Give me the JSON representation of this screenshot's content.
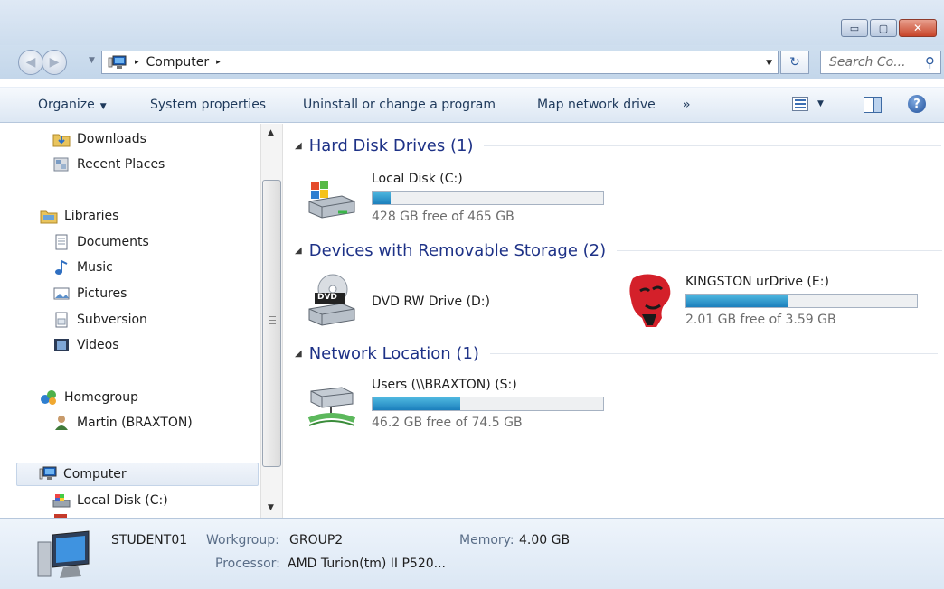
{
  "window": {
    "minimize_glyph": "▭",
    "maximize_glyph": "▢",
    "close_glyph": "✕"
  },
  "address": {
    "crumbs": [
      "Computer"
    ],
    "separator": "▸",
    "search_placeholder": "Search Co...",
    "refresh_glyph": "↻"
  },
  "commands": {
    "organize": "Organize",
    "system_properties": "System properties",
    "uninstall": "Uninstall or change a program",
    "map_drive": "Map network drive",
    "more": "»"
  },
  "nav": {
    "items": [
      {
        "label": "Downloads",
        "icon": "downloads-folder-icon"
      },
      {
        "label": "Recent Places",
        "icon": "recent-places-icon"
      },
      {
        "label": "Libraries",
        "icon": "libraries-icon"
      },
      {
        "label": "Documents",
        "icon": "documents-icon"
      },
      {
        "label": "Music",
        "icon": "music-icon"
      },
      {
        "label": "Pictures",
        "icon": "pictures-icon"
      },
      {
        "label": "Subversion",
        "icon": "subversion-icon"
      },
      {
        "label": "Videos",
        "icon": "videos-icon"
      },
      {
        "label": "Homegroup",
        "icon": "homegroup-icon"
      },
      {
        "label": "Martin (BRAXTON)",
        "icon": "user-icon"
      },
      {
        "label": "Computer",
        "icon": "computer-icon"
      },
      {
        "label": "Local Disk (C:)",
        "icon": "local-disk-icon"
      }
    ]
  },
  "groups": {
    "hdd": {
      "title": "Hard Disk Drives (1)"
    },
    "removable": {
      "title": "Devices with Removable Storage (2)"
    },
    "network": {
      "title": "Network Location (1)"
    }
  },
  "drives": {
    "c": {
      "name": "Local Disk (C:)",
      "free_text": "428 GB free of 465 GB",
      "used_fraction": 0.08
    },
    "d": {
      "name": "DVD RW Drive (D:)",
      "badge": "DVD"
    },
    "e": {
      "name": "KINGSTON urDrive (E:)",
      "free_text": "2.01 GB free of 3.59 GB",
      "used_fraction": 0.44
    },
    "s": {
      "name": "Users (\\\\BRAXTON) (S:)",
      "free_text": "46.2 GB free of 74.5 GB",
      "used_fraction": 0.38
    }
  },
  "details": {
    "computer_name": "STUDENT01",
    "workgroup_label": "Workgroup:",
    "workgroup": "GROUP2",
    "memory_label": "Memory:",
    "memory": "4.00 GB",
    "processor_label": "Processor:",
    "processor": "AMD Turion(tm) II P520..."
  },
  "colors": {
    "group_title": "#1e3287",
    "bar_fill": "#1b7fbc",
    "accent": "#3d6aa3"
  }
}
